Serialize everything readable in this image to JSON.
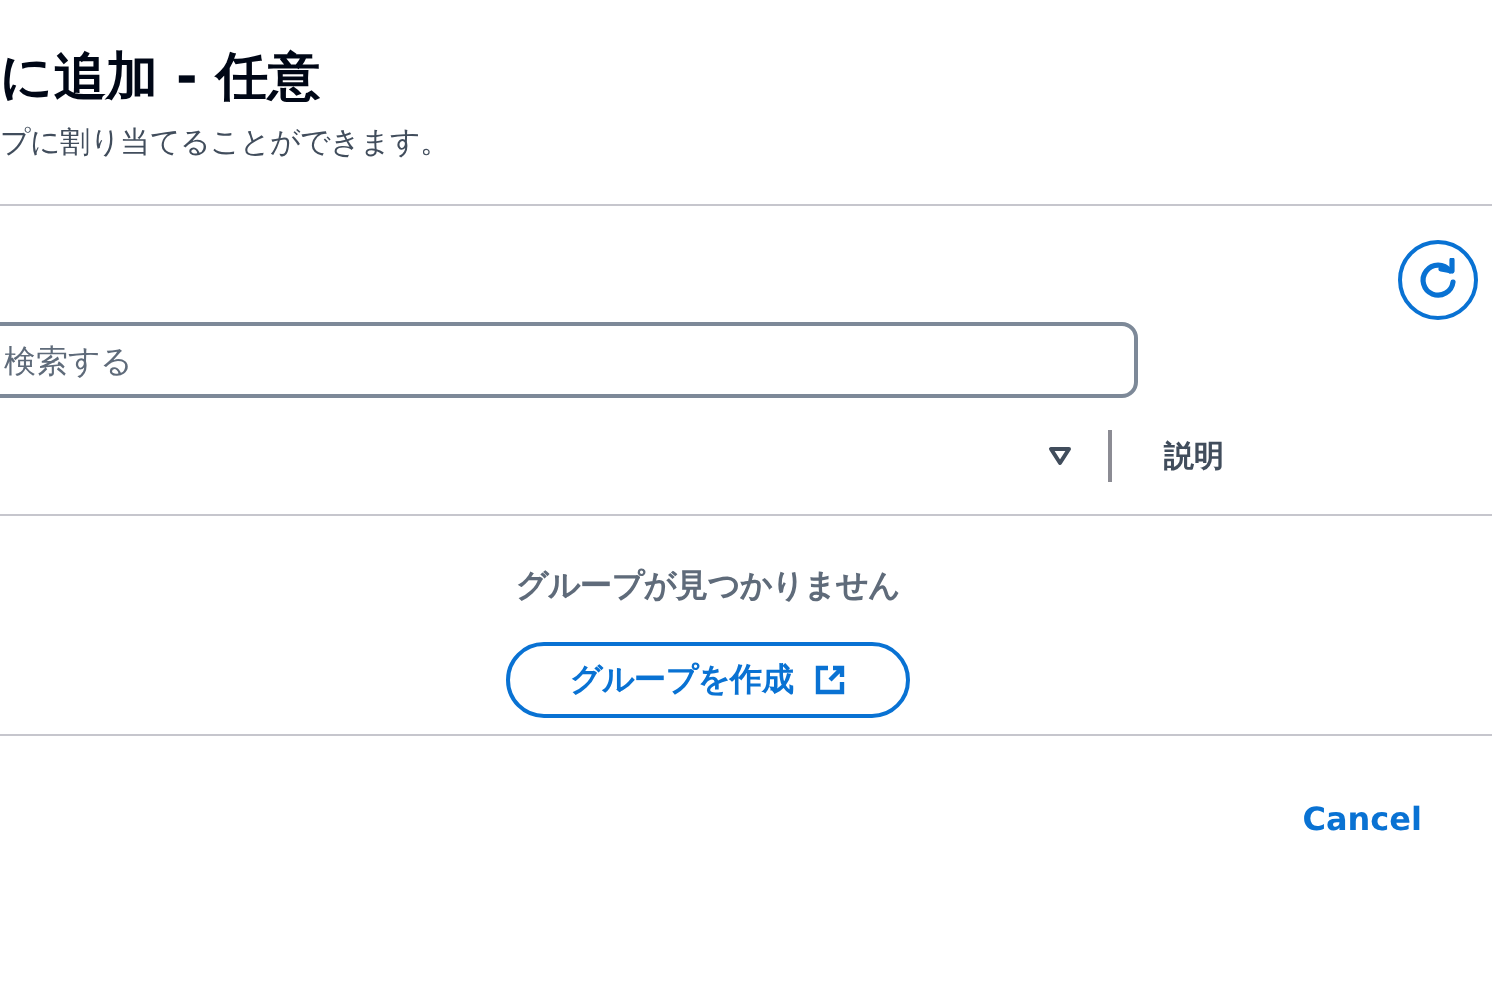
{
  "header": {
    "title": "に追加 - 任意",
    "description": "プに割り当てることができます。"
  },
  "search": {
    "placeholder": "検索する"
  },
  "table": {
    "columns": [
      {
        "label": "説明"
      }
    ]
  },
  "empty_state": {
    "message": "グループが見つかりません",
    "button": "グループを作成"
  },
  "footer": {
    "buttons": [
      "Cancel"
    ]
  }
}
